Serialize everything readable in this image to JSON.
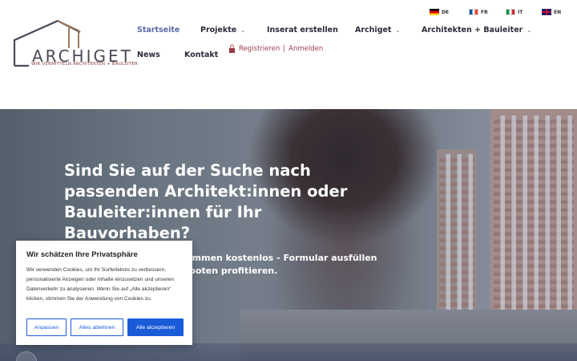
{
  "brand": {
    "name_part1": "ARCHI",
    "name_part2": "GET",
    "tagline": "WIR VERMITTELN ARCHITEKTEN + BAULEITER"
  },
  "languages": [
    {
      "code": "DE",
      "flag": "flag-de-icon"
    },
    {
      "code": "FR",
      "flag": "flag-fr-icon"
    },
    {
      "code": "IT",
      "flag": "flag-it-icon"
    },
    {
      "code": "EN",
      "flag": "flag-en-icon"
    }
  ],
  "nav": {
    "startseite": "Startseite",
    "projekte": "Projekte",
    "inserat": "Inserat erstellen",
    "archiget": "Archiget",
    "architekten": "Architekten + Bauleiter",
    "news": "News",
    "kontakt": "Kontakt"
  },
  "auth": {
    "register": "Registrieren",
    "separator": "|",
    "login": "Anmelden"
  },
  "hero": {
    "title": "Sind Sie auf der Suche nach passenden Architekt:innen oder Bauleiter:innen für Ihr Bauvorhaben?",
    "subtitle": "Inserat schnell und vollkommen kostenlos - Formular ausfüllen und von passenden Angeboten profitieren."
  },
  "cookie": {
    "title": "Wir schätzen Ihre Privatsphäre",
    "text": "Wir verwenden Cookies, um Ihr Surferlebnis zu verbessern, personalisierte Anzeigen oder Inhalte einzusetzen und unseren Datenverkehr zu analysieren. Wenn Sie auf „Alle akzeptieren“ klicken, stimmen Sie der Anwendung von Cookies zu.",
    "btn_customize": "Anpassen",
    "btn_reject": "Alles ablehnen",
    "btn_accept": "Alle akzeptieren"
  },
  "colors": {
    "accent_nav": "#5b6aa8",
    "auth_red": "#9b3a4a",
    "button_blue": "#1a5bd8"
  }
}
